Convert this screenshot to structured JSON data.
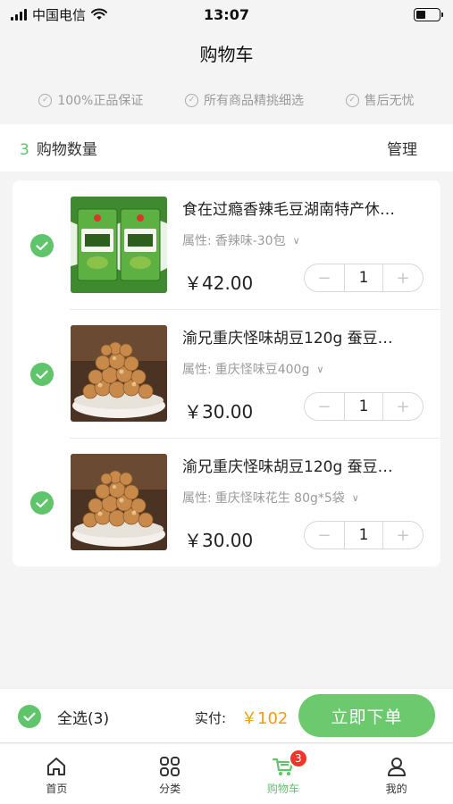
{
  "status_bar": {
    "carrier": "中国电信",
    "time": "13:07"
  },
  "page_title": "购物车",
  "guarantees": [
    {
      "icon": "check-circle-icon",
      "label": "100%正品保证"
    },
    {
      "icon": "check-circle-icon",
      "label": "所有商品精挑细选"
    },
    {
      "icon": "check-circle-icon",
      "label": "售后无忧"
    }
  ],
  "cart_header": {
    "count": "3",
    "count_label": "购物数量",
    "manage": "管理"
  },
  "items": [
    {
      "title": "食在过瘾香辣毛豆湖南特产休…",
      "attr_label": "属性:",
      "attr_value": "香辣味-30包",
      "price": "￥42.00",
      "qty": "1",
      "checked": true
    },
    {
      "title": "渝兄重庆怪味胡豆120g 蚕豆…",
      "attr_label": "属性:",
      "attr_value": "重庆怪味豆400g",
      "price": "￥30.00",
      "qty": "1",
      "checked": true
    },
    {
      "title": "渝兄重庆怪味胡豆120g 蚕豆…",
      "attr_label": "属性:",
      "attr_value": "重庆怪味花生 80g*5袋",
      "price": "￥30.00",
      "qty": "1",
      "checked": true
    }
  ],
  "stepper": {
    "minus": "−",
    "plus": "+"
  },
  "bottom": {
    "select_all": "全选(3)",
    "paid_label": "实付:",
    "total": "￥102",
    "checkout": "立即下单"
  },
  "tabs": [
    {
      "label": "首页",
      "icon": "home-icon"
    },
    {
      "label": "分类",
      "icon": "category-icon"
    },
    {
      "label": "购物车",
      "icon": "cart-icon",
      "badge": "3",
      "active": true
    },
    {
      "label": "我的",
      "icon": "user-icon"
    }
  ],
  "colors": {
    "accent": "#5fc46a",
    "price_orange": "#f39c12",
    "badge_red": "#f2352c"
  }
}
